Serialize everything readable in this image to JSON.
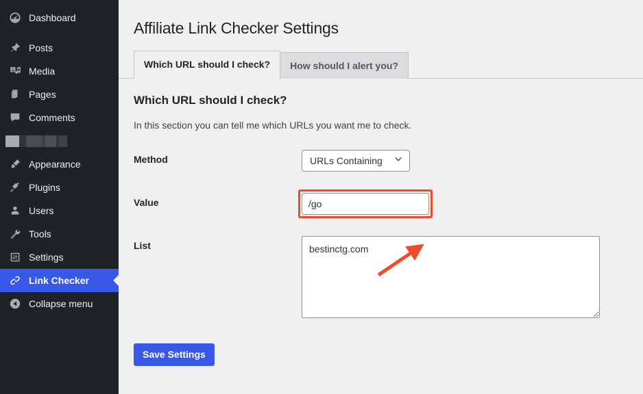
{
  "sidebar": {
    "items": [
      {
        "label": "Dashboard",
        "icon": "dashboard-icon",
        "state": "normal"
      },
      {
        "label": "Posts",
        "icon": "pushpin-icon",
        "state": "normal"
      },
      {
        "label": "Media",
        "icon": "media-icon",
        "state": "normal"
      },
      {
        "label": "Pages",
        "icon": "pages-icon",
        "state": "normal"
      },
      {
        "label": "Comments",
        "icon": "comment-icon",
        "state": "normal"
      },
      {
        "label": "",
        "icon": "redacted-icon",
        "state": "redacted"
      },
      {
        "label": "Appearance",
        "icon": "paintbrush-icon",
        "state": "normal"
      },
      {
        "label": "Plugins",
        "icon": "plug-icon",
        "state": "normal"
      },
      {
        "label": "Users",
        "icon": "user-icon",
        "state": "normal"
      },
      {
        "label": "Tools",
        "icon": "wrench-icon",
        "state": "normal"
      },
      {
        "label": "Settings",
        "icon": "sliders-icon",
        "state": "normal"
      },
      {
        "label": "Link Checker",
        "icon": "link-icon",
        "state": "active"
      },
      {
        "label": "Collapse menu",
        "icon": "collapse-icon",
        "state": "normal"
      }
    ],
    "active_color": "#3858e9",
    "background_color": "#1d2327"
  },
  "header": {
    "title": "Affiliate Link Checker Settings"
  },
  "tabs": [
    {
      "label": "Which URL should I check?",
      "active": true
    },
    {
      "label": "How should I alert you?",
      "active": false
    }
  ],
  "section": {
    "title": "Which URL should I check?",
    "description": "In this section you can tell me which URLs you want me to check."
  },
  "form": {
    "method": {
      "label": "Method",
      "selected": "URLs Containing",
      "options": [
        "URLs Containing"
      ],
      "chevron_icon": "chevron-down-icon"
    },
    "value": {
      "label": "Value",
      "value": "/go",
      "placeholder": "",
      "highlighted": true
    },
    "list": {
      "label": "List",
      "value": "bestinctg.com",
      "placeholder": ""
    }
  },
  "actions": {
    "save_label": "Save Settings"
  },
  "annotations": {
    "highlight_color": "#f04a28",
    "arrow_color": "#ee4b2b",
    "arrow_target": "list-textarea"
  }
}
